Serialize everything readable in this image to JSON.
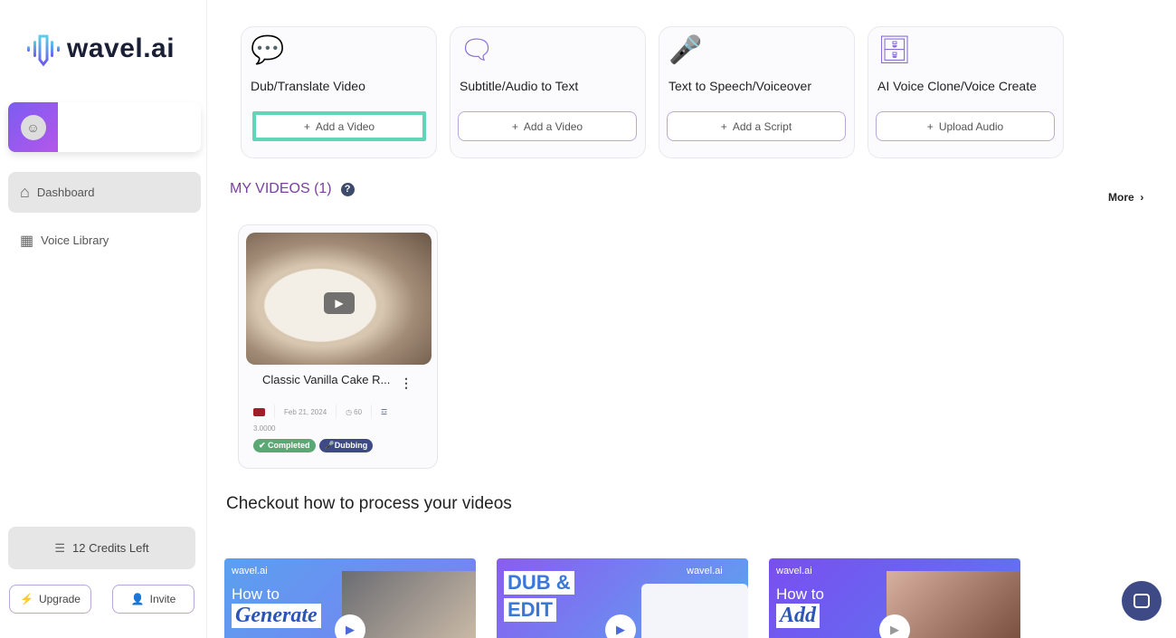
{
  "brand": {
    "name": "wavel.ai"
  },
  "sidebar": {
    "items": [
      {
        "label": "Dashboard",
        "icon": "home-icon"
      },
      {
        "label": "Voice Library",
        "icon": "grid-icon"
      }
    ],
    "credits": "12 Credits Left",
    "upgrade": "Upgrade",
    "invite": "Invite"
  },
  "tools": [
    {
      "title": "Dub/Translate Video",
      "button": "Add a Video",
      "icon": "translate-icon"
    },
    {
      "title": "Subtitle/Audio to Text",
      "button": "Add a Video",
      "icon": "subtitle-icon"
    },
    {
      "title": "Text to Speech/Voiceover",
      "button": "Add a Script",
      "icon": "microphone-icon"
    },
    {
      "title": "AI Voice Clone/Voice Create",
      "button": "Upload Audio",
      "icon": "voice-clone-icon"
    }
  ],
  "my_videos": {
    "heading": "MY VIDEOS (1)",
    "more": "More",
    "help": "?",
    "videos": [
      {
        "title": "Classic Vanilla Cake R...",
        "date": "Feb 21, 2024",
        "duration": "60",
        "score": "3.0000",
        "status": "Completed",
        "type": "Dubbing"
      }
    ]
  },
  "tutorials": {
    "heading": "Checkout how to process your videos",
    "items": [
      {
        "brand": "wavel.ai",
        "line1": "How to",
        "line2": "Generate"
      },
      {
        "brand": "wavel.ai",
        "line1": "DUB &",
        "line2": "EDIT"
      },
      {
        "brand": "wavel.ai",
        "line1": "How to",
        "line2": "Add"
      }
    ]
  },
  "colors": {
    "accent": "#7a3fa0",
    "focus": "#5fd6b8",
    "completed": "#5aa874",
    "dubbing": "#3d4a86"
  }
}
